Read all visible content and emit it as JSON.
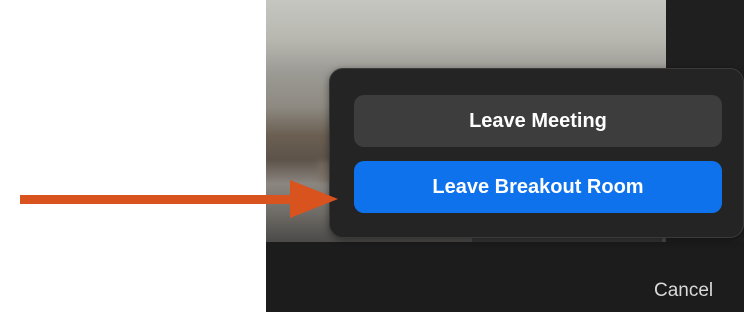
{
  "dialog": {
    "leave_meeting_label": "Leave Meeting",
    "leave_breakout_label": "Leave Breakout Room",
    "cancel_label": "Cancel"
  },
  "colors": {
    "primary_button": "#0e72ed",
    "secondary_button": "#3d3d3d",
    "popup_background": "#242424",
    "window_background": "#1c1c1c",
    "annotation_arrow": "#d9531e"
  },
  "annotation": {
    "icon": "arrow-right-icon",
    "target": "leave-breakout-room-button"
  }
}
